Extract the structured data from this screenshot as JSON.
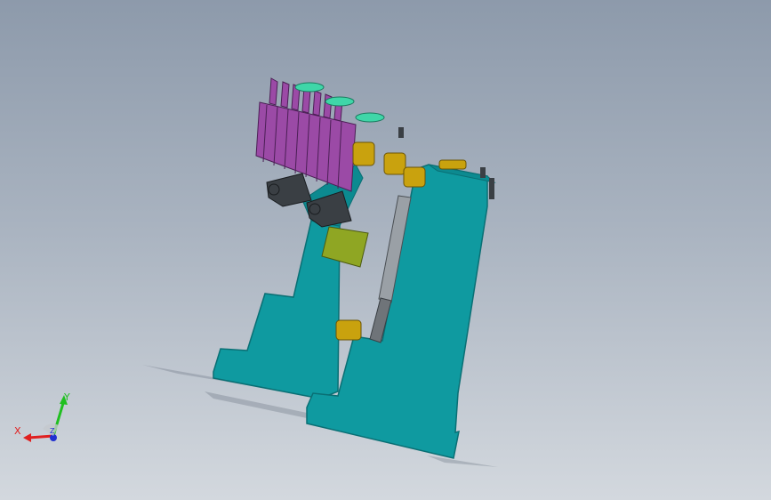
{
  "triad": {
    "x_label": "X",
    "y_label": "Y",
    "z_label": "Z"
  },
  "colors": {
    "background_top": "#8d9aab",
    "background_bottom": "#d3d8de",
    "body": "#0f9aa0",
    "body_edge": "#0a6f74",
    "fingers": "#9b4aa6",
    "bushings": "#c9a20e",
    "rod": "#8a8f95",
    "block": "#8fa623",
    "axis_x": "#e02020",
    "axis_y": "#20c020",
    "axis_z": "#2030d0"
  },
  "icons": {
    "triad": "coordinate-triad-icon"
  }
}
